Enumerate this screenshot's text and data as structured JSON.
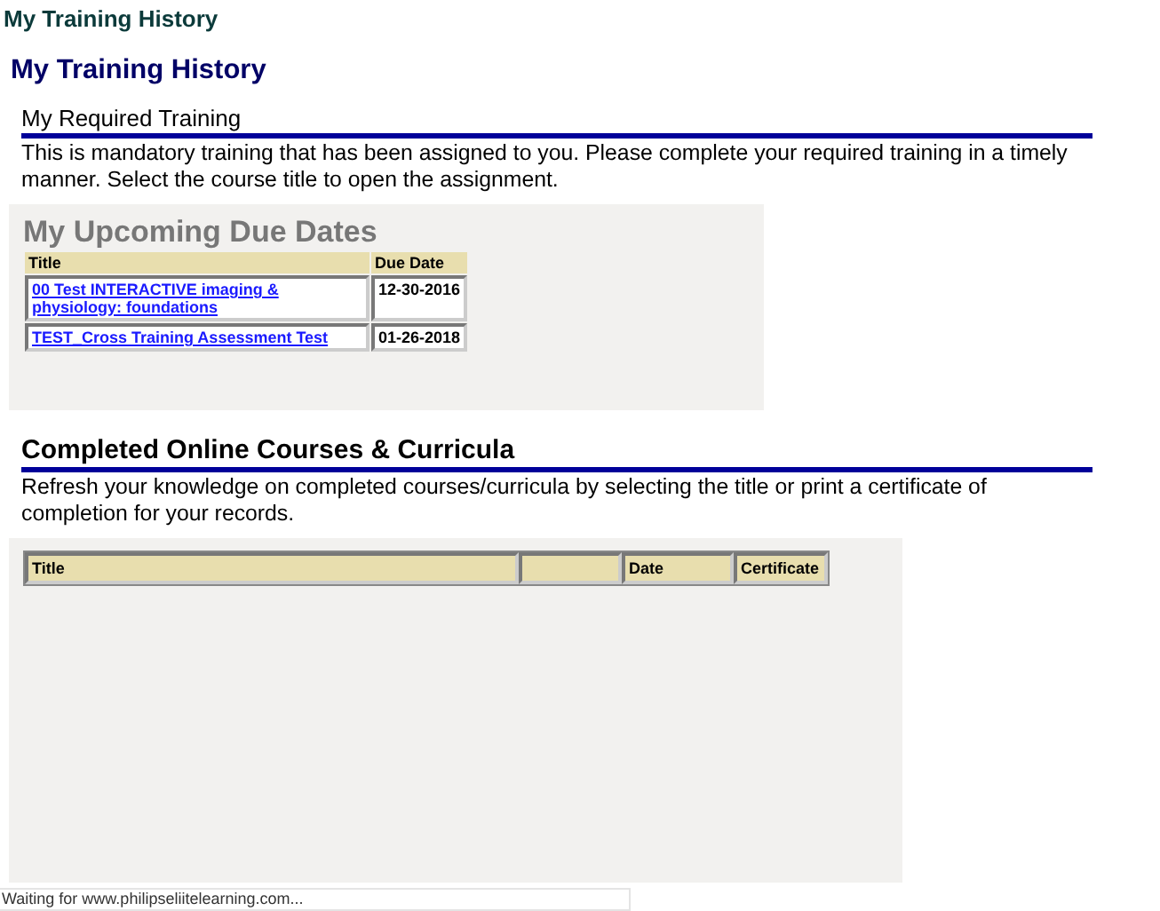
{
  "page_title": "My Training History",
  "heading": "My Training History",
  "required": {
    "title": "My Required Training",
    "description": "This is mandatory training that has been assigned to you. Please complete your required training in a timely manner. Select the course title to open the assignment.",
    "panel_title": "My Upcoming Due Dates",
    "columns": [
      "Title",
      "Due Date"
    ],
    "rows": [
      {
        "title": "00 Test INTERACTIVE imaging & physiology: foundations",
        "due": "12-30-2016"
      },
      {
        "title": "TEST_Cross Training Assessment Test",
        "due": "01-26-2018"
      }
    ]
  },
  "completed": {
    "title": "Completed Online Courses & Curricula",
    "description": "Refresh your knowledge on completed courses/curricula by selecting the title or print a certificate of completion for your records.",
    "columns": [
      "Title",
      "",
      "Date",
      "Certificate"
    ]
  },
  "status_bar": "Waiting for www.philipseliitelearning.com..."
}
